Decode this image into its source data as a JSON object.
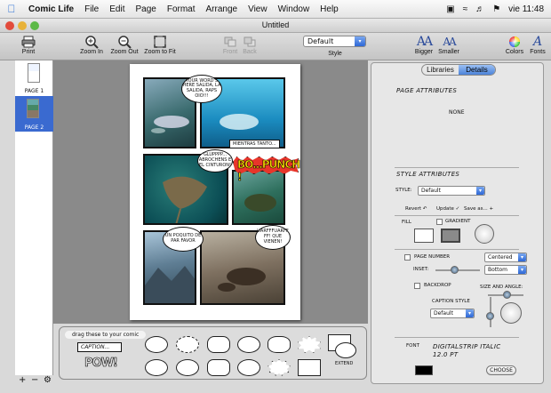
{
  "menubar": {
    "app": "Comic Life",
    "items": [
      "File",
      "Edit",
      "Page",
      "Format",
      "Arrange",
      "View",
      "Window",
      "Help"
    ],
    "clock": "vie 11:48"
  },
  "window": {
    "title": "Untitled"
  },
  "toolbar": {
    "print": "Print",
    "zoom_in": "Zoom In",
    "zoom_out": "Zoom Out",
    "zoom_fit": "Zoom to Fit",
    "front": "Front",
    "back": "Back",
    "style_label": "Style",
    "style_value": "Default",
    "bigger": "Bigger",
    "smaller": "Smaller",
    "colors": "Colors",
    "fonts": "Fonts"
  },
  "pages": [
    {
      "label": "PAGE 1"
    },
    {
      "label": "PAGE 2",
      "selected": true
    }
  ],
  "comic": {
    "bubble1": "YOUR WORD'S HERE SALIDA, LA SALIDA, RAPS OIO!!!",
    "caption1": "MIENTRAS TANTO...",
    "bubble2": "GLUPPPP... ABROCHENS E EL CINTURON!",
    "pow_text": "BO...PUNCH !",
    "bubble3": "UN POQUITO DE PAR FAVOR",
    "bubble4": "UARFFFUARFF FF! QUE VIENEN!"
  },
  "palette": {
    "header": "drag these to your comic",
    "caption": "CAPTION...",
    "pow": "POW!",
    "extend": "EXTEND"
  },
  "inspector": {
    "tabs": [
      {
        "label": "Libraries",
        "active": false
      },
      {
        "label": "Details",
        "active": true
      }
    ],
    "page_attributes": "PAGE ATTRIBUTES",
    "none": "NONE",
    "style_attributes": "STYLE ATTRIBUTES",
    "style_label": "STYLE:",
    "style_value": "Default",
    "revert": "Revert",
    "update": "Update",
    "save_as": "Save as...",
    "fill": "FILL",
    "gradient": "GRADIENT",
    "page_number": "PAGE NUMBER",
    "centered": "Centered",
    "inset": "INSET:",
    "bottom": "Bottom",
    "backdrop": "BACKDROP",
    "size_angle": "SIZE AND ANGLE:",
    "caption_style": "CAPTION STYLE",
    "caption_value": "Default",
    "font_label": "FONT",
    "font_value": "DIGITALSTRIP ITALIC 12.0 PT",
    "choose": "CHOOSE"
  },
  "colors": {
    "accent": "#3a6ad0",
    "inspector_bg": "#e7e7e7",
    "canvas": "#8a8a8a"
  }
}
